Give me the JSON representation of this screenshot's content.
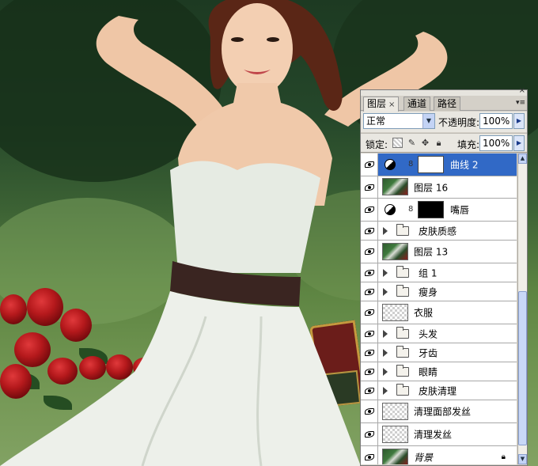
{
  "panel": {
    "tabs": [
      {
        "label": "图层",
        "close": "×",
        "active": true
      },
      {
        "label": "通道",
        "active": false
      },
      {
        "label": "路径",
        "active": false
      }
    ],
    "menu_glyph": "▾≡",
    "blend_mode": "正常",
    "opacity_label": "不透明度:",
    "opacity_value": "100%",
    "lock_label": "锁定:",
    "fill_label": "填充:",
    "fill_value": "100%",
    "lock_icons": [
      "transparency-lock-icon",
      "paint-lock-icon",
      "move-lock-icon",
      "all-lock-icon"
    ]
  },
  "layers": [
    {
      "name": "曲线 2",
      "kind": "adjustment",
      "mask": "white",
      "selected": true
    },
    {
      "name": "图层 16",
      "kind": "pixel",
      "thumb": "photo"
    },
    {
      "name": "嘴唇",
      "kind": "adjustment",
      "mask": "black"
    },
    {
      "name": "皮肤质感",
      "kind": "group"
    },
    {
      "name": "图层 13",
      "kind": "pixel",
      "thumb": "photo"
    },
    {
      "name": "组 1",
      "kind": "group"
    },
    {
      "name": "瘦身",
      "kind": "group"
    },
    {
      "name": "衣服",
      "kind": "pixel",
      "thumb": "checker"
    },
    {
      "name": "头发",
      "kind": "group"
    },
    {
      "name": "牙齿",
      "kind": "group"
    },
    {
      "name": "眼睛",
      "kind": "group"
    },
    {
      "name": "皮肤清理",
      "kind": "group"
    },
    {
      "name": "清理面部发丝",
      "kind": "pixel",
      "thumb": "checker"
    },
    {
      "name": "清理发丝",
      "kind": "pixel",
      "thumb": "checker"
    },
    {
      "name": "背景",
      "kind": "pixel",
      "thumb": "photo",
      "locked": true,
      "italic": true
    }
  ],
  "colors": {
    "selection": "#3169c6",
    "panel_bg": "#d4d0c8",
    "dress": "#e9ede6",
    "belt": "#3a2521"
  }
}
